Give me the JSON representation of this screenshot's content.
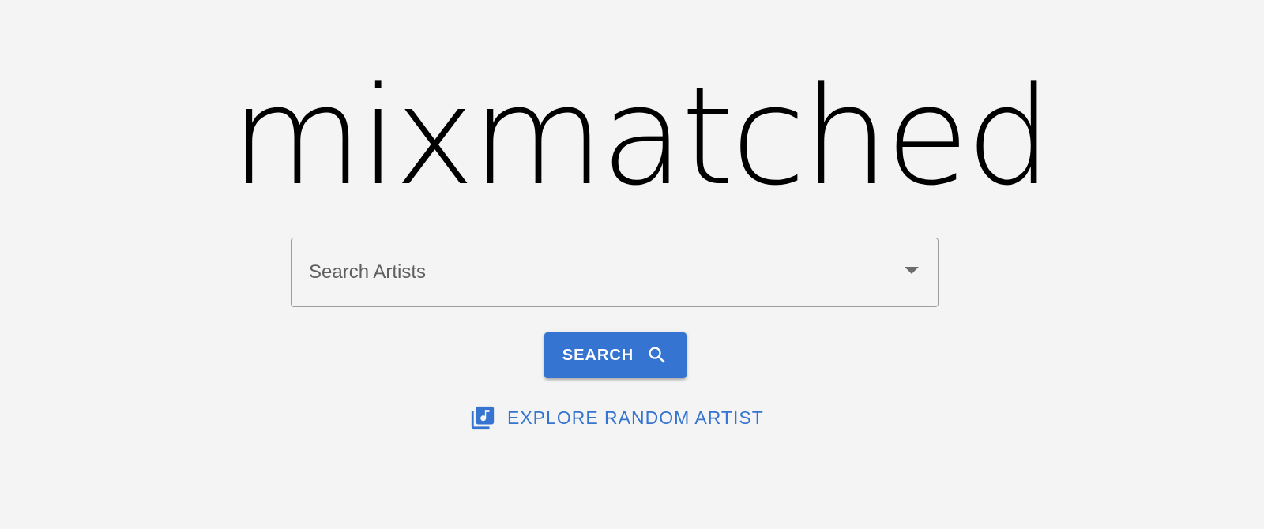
{
  "app": {
    "logo_text": "mixmatched"
  },
  "search": {
    "placeholder": "Search Artists",
    "value": "",
    "dropdown_icon": "chevron-down-icon"
  },
  "search_button": {
    "label": "SEARCH",
    "icon": "search-icon"
  },
  "random_link": {
    "label": "EXPLORE RANDOM ARTIST",
    "icon": "library-music-icon"
  },
  "colors": {
    "background": "#f4f4f4",
    "accent": "#3574d0",
    "text": "#000000"
  }
}
